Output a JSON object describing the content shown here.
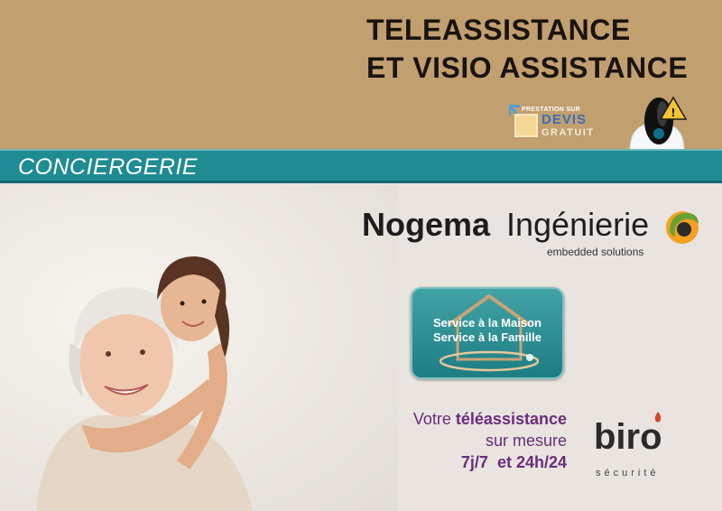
{
  "header": {
    "title_line1": "TELEASSISTANCE",
    "title_line2": "ET VISIO ASSISTANCE"
  },
  "badge": {
    "top": "PRESTATION SUR",
    "main": "DEVIS",
    "bottom": "GRATUIT"
  },
  "band": {
    "label": "CONCIERGERIE"
  },
  "nogema": {
    "name_bold": "Nogema",
    "name_light": "Ingénierie",
    "tagline": "embedded solutions"
  },
  "service": {
    "line1": "Service à la Maison",
    "line2": "Service à la Famille"
  },
  "promo": {
    "line1_pre": "Votre ",
    "line1_bold": "téléassistance",
    "line2_pre": "sur mesure ",
    "line2_bold": "7j/7  et 24h/24"
  },
  "biro": {
    "name": "biro",
    "sub": "sécurité"
  },
  "colors": {
    "top_band": "#c29f6f",
    "teal_band": "#1f8c93",
    "promo_text": "#6a2c7d",
    "title_text": "#1a1410"
  }
}
